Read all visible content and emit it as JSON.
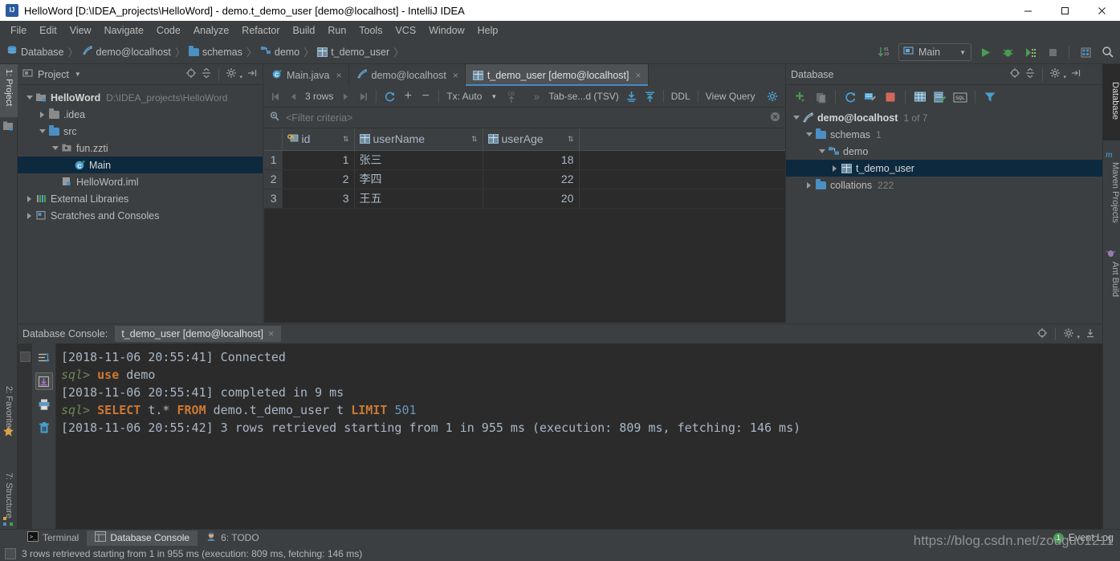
{
  "window": {
    "title": "HelloWord [D:\\IDEA_projects\\HelloWord] - demo.t_demo_user [demo@localhost] - IntelliJ IDEA",
    "minimize": "—",
    "maximize": "☐",
    "close": "✕"
  },
  "menu": {
    "items": [
      {
        "label": "File"
      },
      {
        "label": "Edit"
      },
      {
        "label": "View"
      },
      {
        "label": "Navigate"
      },
      {
        "label": "Code"
      },
      {
        "label": "Analyze"
      },
      {
        "label": "Refactor"
      },
      {
        "label": "Build"
      },
      {
        "label": "Run"
      },
      {
        "label": "Tools"
      },
      {
        "label": "VCS"
      },
      {
        "label": "Window"
      },
      {
        "label": "Help"
      }
    ]
  },
  "breadcrumb": {
    "items": [
      {
        "label": "Database",
        "icon": "database-icon"
      },
      {
        "label": "demo@localhost",
        "icon": "datasource-icon"
      },
      {
        "label": "schemas",
        "icon": "folder-icon"
      },
      {
        "label": "demo",
        "icon": "schema-icon"
      },
      {
        "label": "t_demo_user",
        "icon": "table-icon"
      }
    ],
    "separator": "〉"
  },
  "toolbar": {
    "run_config": "Main",
    "run_config_dropdown": "▼",
    "buttons": [
      {
        "name": "compare-icon",
        "label": ""
      },
      {
        "name": "run-icon",
        "label": ""
      },
      {
        "name": "debug-icon",
        "label": ""
      },
      {
        "name": "run-coverage-icon",
        "label": ""
      },
      {
        "name": "stop-icon",
        "label": ""
      },
      {
        "name": "layout-icon",
        "label": ""
      },
      {
        "name": "search-icon",
        "label": ""
      }
    ]
  },
  "left_stripe": {
    "tabs": [
      {
        "label": "1: Project",
        "active": true
      },
      {
        "label": "2: Favorites",
        "active": false
      },
      {
        "label": "7: Structure",
        "active": false
      }
    ]
  },
  "right_stripe": {
    "tabs": [
      {
        "label": "Database",
        "active": true
      },
      {
        "label": "Maven Projects",
        "active": false
      },
      {
        "label": "Ant Build",
        "active": false
      }
    ]
  },
  "project_panel": {
    "title": "Project",
    "title_dropdown": "▼",
    "tree": [
      {
        "indent": 0,
        "twisty": "down",
        "icon": "module-icon",
        "label": "HelloWord",
        "sub": "D:\\IDEA_projects\\HelloWord",
        "bold": true,
        "selected": false
      },
      {
        "indent": 1,
        "twisty": "right",
        "icon": "folder-gray-icon",
        "label": ".idea",
        "sub": "",
        "bold": false,
        "selected": false
      },
      {
        "indent": 1,
        "twisty": "down",
        "icon": "source-folder-icon",
        "label": "src",
        "sub": "",
        "bold": false,
        "selected": false
      },
      {
        "indent": 2,
        "twisty": "down",
        "icon": "package-icon",
        "label": "fun.zzti",
        "sub": "",
        "bold": false,
        "selected": false
      },
      {
        "indent": 3,
        "twisty": "none",
        "icon": "java-class-icon",
        "label": "Main",
        "sub": "",
        "bold": false,
        "selected": true
      },
      {
        "indent": 2,
        "twisty": "none",
        "icon": "iml-file-icon",
        "label": "HelloWord.iml",
        "sub": "",
        "bold": false,
        "selected": false
      },
      {
        "indent": 0,
        "twisty": "right",
        "icon": "library-icon",
        "label": "External Libraries",
        "sub": "",
        "bold": false,
        "selected": false
      },
      {
        "indent": 0,
        "twisty": "right",
        "icon": "scratches-icon",
        "label": "Scratches and Consoles",
        "sub": "",
        "bold": false,
        "selected": false
      }
    ]
  },
  "editor": {
    "tabs": [
      {
        "label": "Main.java",
        "icon": "java-class-icon",
        "active": false,
        "close": "×"
      },
      {
        "label": "demo@localhost",
        "icon": "datasource-icon",
        "active": false,
        "close": "×"
      },
      {
        "label": "t_demo_user [demo@localhost]",
        "icon": "table-icon",
        "active": true,
        "close": "×"
      }
    ]
  },
  "grid_toolbar": {
    "first_page": "⏮",
    "prev_page": "◀",
    "row_count": "3 rows",
    "next_page": "▶",
    "last_page": "⏭",
    "reload": "reload-icon",
    "add_row": "+",
    "delete_row": "−",
    "tx_label": "Tx: Auto",
    "tx_dropdown": "▼",
    "db_label": "DB",
    "chevron": "»",
    "format_label": "Tab-se...d (TSV)",
    "export_icon": "export-icon",
    "import_icon": "import-icon",
    "ddl_label": "DDL",
    "view_query_label": "View Query",
    "settings_icon": "gear-icon"
  },
  "filter_bar": {
    "icon": "filter-search-icon",
    "placeholder": "<Filter criteria>",
    "clear_icon": "clear-icon"
  },
  "data_table": {
    "columns": [
      {
        "name": "id",
        "icon": "primary-key-icon",
        "sortable": true
      },
      {
        "name": "userName",
        "icon": "column-icon",
        "sortable": true
      },
      {
        "name": "userAge",
        "icon": "column-icon",
        "sortable": true
      }
    ],
    "sort_glyph": "⇅",
    "rows": [
      {
        "num": "1",
        "id": "1",
        "userName": "张三",
        "userAge": "18"
      },
      {
        "num": "2",
        "id": "2",
        "userName": "李四",
        "userAge": "22"
      },
      {
        "num": "3",
        "id": "3",
        "userName": "王五",
        "userAge": "20"
      }
    ]
  },
  "database_panel": {
    "title": "Database",
    "toolbar": [
      {
        "name": "add-datasource-icon"
      },
      {
        "name": "copy-icon"
      },
      {
        "name": "refresh-icon"
      },
      {
        "name": "datasource-properties-icon"
      },
      {
        "name": "stop-icon"
      },
      {
        "name": "open-table-icon"
      },
      {
        "name": "edit-data-icon"
      },
      {
        "name": "sql-console-icon"
      },
      {
        "name": "filter-icon"
      }
    ],
    "tree": [
      {
        "indent": 0,
        "twisty": "down",
        "icon": "datasource-icon",
        "label": "demo@localhost",
        "sub": "1 of 7",
        "bold": true,
        "selected": false
      },
      {
        "indent": 1,
        "twisty": "down",
        "icon": "folder-icon",
        "label": "schemas",
        "sub": "1",
        "bold": false,
        "selected": false
      },
      {
        "indent": 2,
        "twisty": "down",
        "icon": "schema-icon",
        "label": "demo",
        "sub": "",
        "bold": false,
        "selected": false
      },
      {
        "indent": 3,
        "twisty": "right",
        "icon": "table-icon",
        "label": "t_demo_user",
        "sub": "",
        "bold": false,
        "selected": true
      },
      {
        "indent": 1,
        "twisty": "right",
        "icon": "folder-icon",
        "label": "collations",
        "sub": "222",
        "bold": false,
        "selected": false
      }
    ]
  },
  "console": {
    "header_label": "Database Console:",
    "tab_label": "t_demo_user [demo@localhost]",
    "tab_close": "×",
    "gutter_icons": [
      {
        "name": "wrap-lines-icon",
        "active": false
      },
      {
        "name": "scroll-to-end-icon",
        "active": true
      },
      {
        "name": "print-icon",
        "active": false
      },
      {
        "name": "clear-all-icon",
        "active": false
      }
    ],
    "lines": [
      {
        "segments": [
          {
            "text": "[2018-11-06 20:55:41] Connected",
            "style": "plain"
          }
        ]
      },
      {
        "segments": [
          {
            "text": "sql> ",
            "style": "prompt"
          },
          {
            "text": "use ",
            "style": "kw"
          },
          {
            "text": "demo",
            "style": "plain"
          }
        ]
      },
      {
        "segments": [
          {
            "text": "[2018-11-06 20:55:41] completed in 9 ms",
            "style": "plain"
          }
        ]
      },
      {
        "segments": [
          {
            "text": "sql> ",
            "style": "prompt"
          },
          {
            "text": "SELECT ",
            "style": "kw"
          },
          {
            "text": "t.* ",
            "style": "plain"
          },
          {
            "text": "FROM ",
            "style": "kw"
          },
          {
            "text": "demo.t_demo_user t ",
            "style": "plain"
          },
          {
            "text": "LIMIT ",
            "style": "kw"
          },
          {
            "text": "501",
            "style": "numlit"
          }
        ]
      },
      {
        "segments": [
          {
            "text": "[2018-11-06 20:55:42] 3 rows retrieved starting from 1 in 955 ms (execution: 809 ms, fetching: 146 ms)",
            "style": "plain"
          }
        ]
      }
    ]
  },
  "bottom_bar": {
    "tabs": [
      {
        "label": "Terminal",
        "icon": "terminal-icon",
        "active": false
      },
      {
        "label": "Database Console",
        "icon": "db-console-icon",
        "active": true
      },
      {
        "label": "6: TODO",
        "icon": "todo-icon",
        "active": false
      }
    ],
    "event_log": "Event Log",
    "event_log_count": "1"
  },
  "status_bar": {
    "message": "3 rows retrieved starting from 1 in 955 ms (execution: 809 ms, fetching: 146 ms)"
  },
  "watermark": {
    "text": "https://blog.csdn.net/zouguo1211"
  },
  "colors": {
    "accent": "#4a88c7",
    "selection": "#0d293e",
    "panel_bg": "#3c3f41",
    "editor_bg": "#2b2b2b",
    "keyword": "#cc7832",
    "string": "#6a8759",
    "number": "#6897bb",
    "text": "#a9b7c6",
    "green_run": "#499c54"
  }
}
